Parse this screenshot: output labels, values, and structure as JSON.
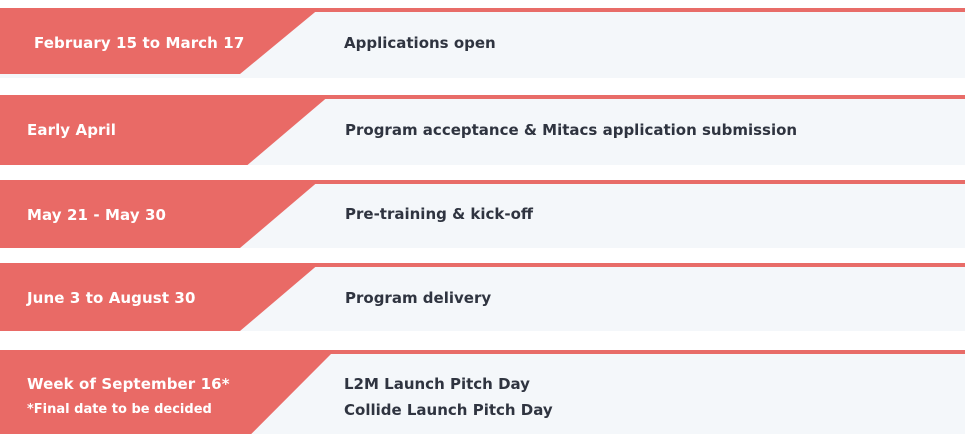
{
  "timeline": {
    "accent_color": "#e96a66",
    "background_color": "#f4f7fa",
    "rows": [
      {
        "date": "February 15  to March 17",
        "events": [
          "Applications open"
        ]
      },
      {
        "date": "Early April",
        "events": [
          "Program acceptance & Mitacs application submission"
        ]
      },
      {
        "date": "May 21 - May 30",
        "events": [
          "Pre-training & kick-off"
        ]
      },
      {
        "date": "June 3 to August 30",
        "events": [
          "Program delivery"
        ]
      },
      {
        "date": "Week of September 16*",
        "date_note": "*Final date to be decided",
        "events": [
          "L2M Launch Pitch Day",
          "Collide Launch Pitch Day"
        ]
      }
    ]
  }
}
